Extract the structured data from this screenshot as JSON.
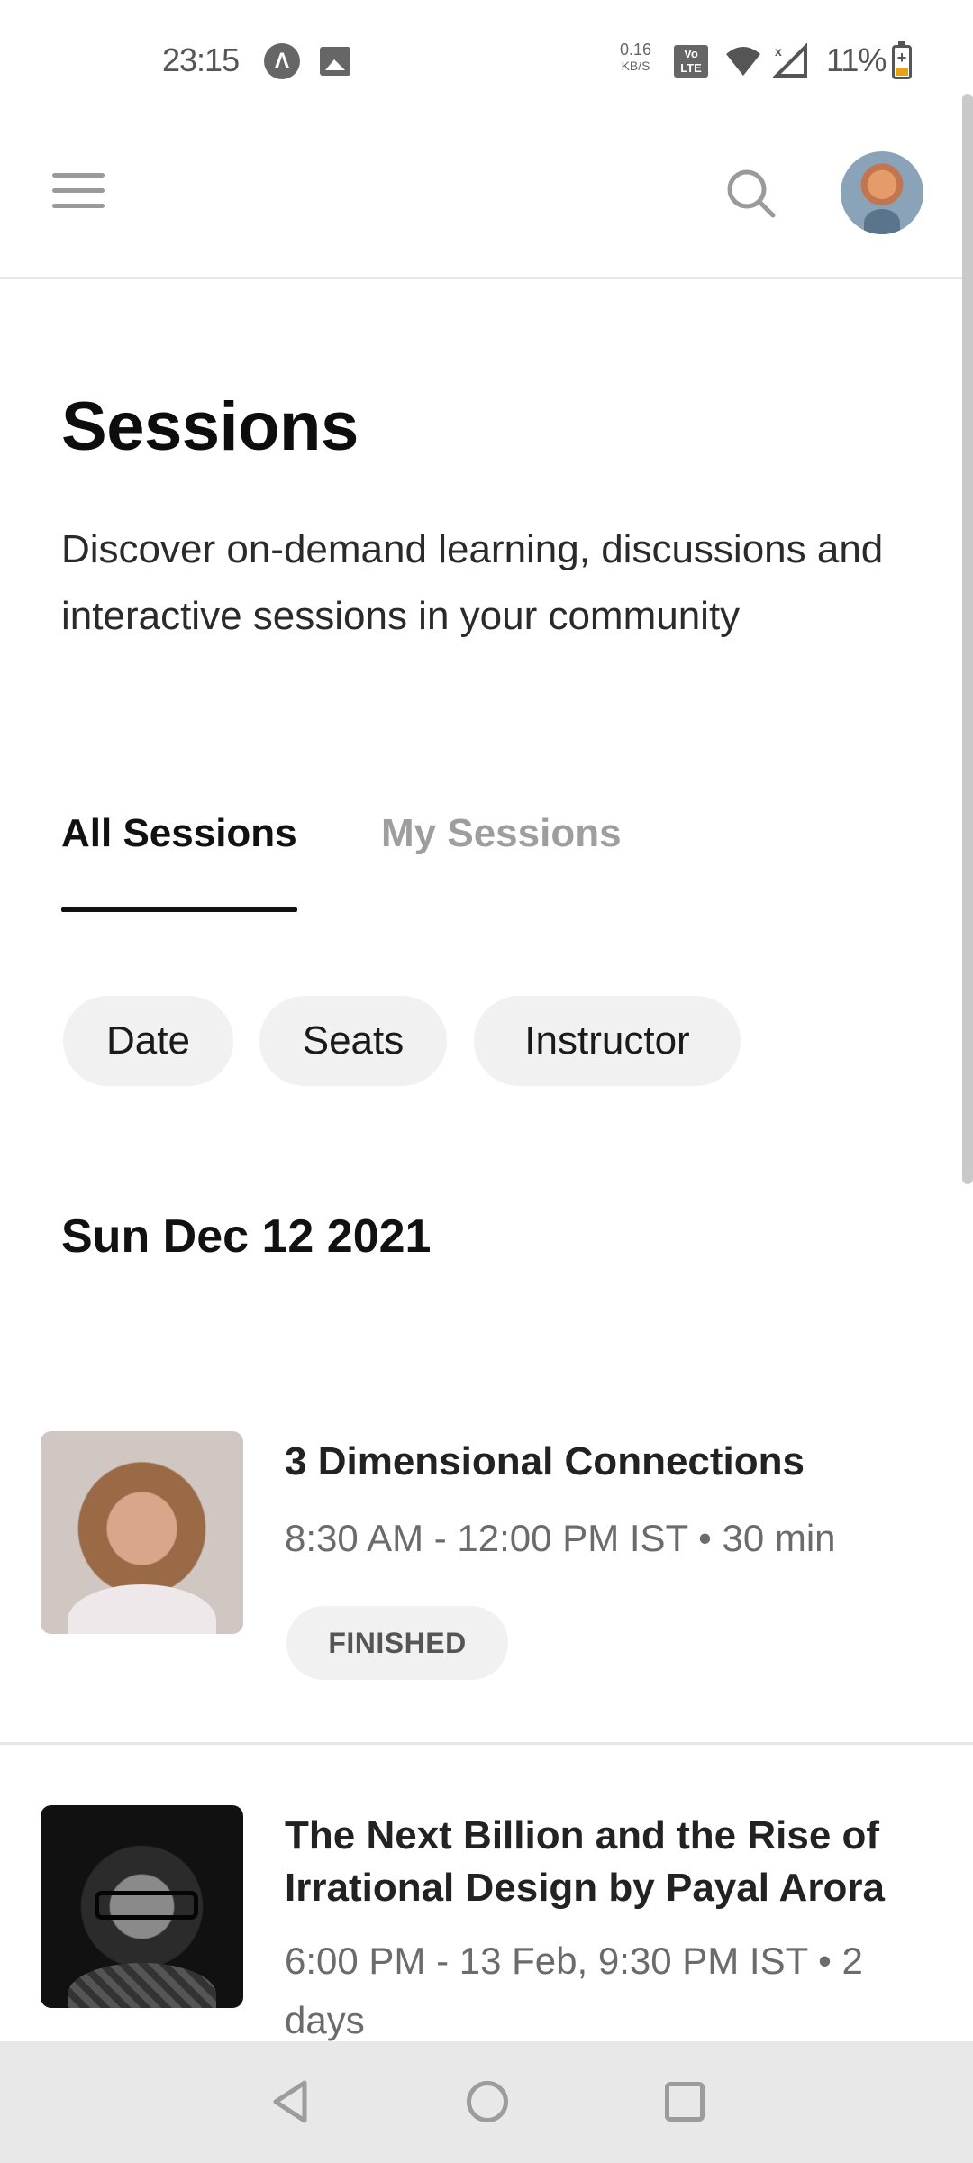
{
  "status_bar": {
    "time": "23:15",
    "speed_value": "0.16",
    "speed_unit": "KB/S",
    "volte_label": "Vo LTE",
    "battery_percent": "11%",
    "icons": [
      "app-notification-icon",
      "image-notification-icon",
      "wifi-icon",
      "signal-icon",
      "battery-charging-icon"
    ]
  },
  "header": {
    "menu_icon": "hamburger-menu-icon",
    "search_icon": "search-icon",
    "avatar": "user-avatar"
  },
  "page": {
    "title": "Sessions",
    "description": "Discover on-demand learning, discussions and interactive sessions in your community"
  },
  "tabs": [
    {
      "label": "All Sessions",
      "active": true
    },
    {
      "label": "My Sessions",
      "active": false
    }
  ],
  "filters": [
    {
      "label": "Date"
    },
    {
      "label": "Seats"
    },
    {
      "label": "Instructor"
    }
  ],
  "date_heading": "Sun Dec 12 2021",
  "sessions": [
    {
      "title": "3 Dimensional Connections",
      "meta": "8:30 AM - 12:00 PM IST • 30 min",
      "status": "FINISHED"
    },
    {
      "title": "The Next Billion and the Rise of Irrational Design by Payal Arora",
      "meta": "6:00 PM - 13 Feb, 9:30 PM IST • 2 days"
    }
  ],
  "nav_bar": {
    "icons": [
      "back-icon",
      "home-icon",
      "recents-icon"
    ]
  },
  "colors": {
    "accent": "#111111",
    "muted_text": "#6b6b6b",
    "chip_bg": "#f1f1f1",
    "nav_bg": "#e8e8e8",
    "battery_low": "#e8a313"
  }
}
